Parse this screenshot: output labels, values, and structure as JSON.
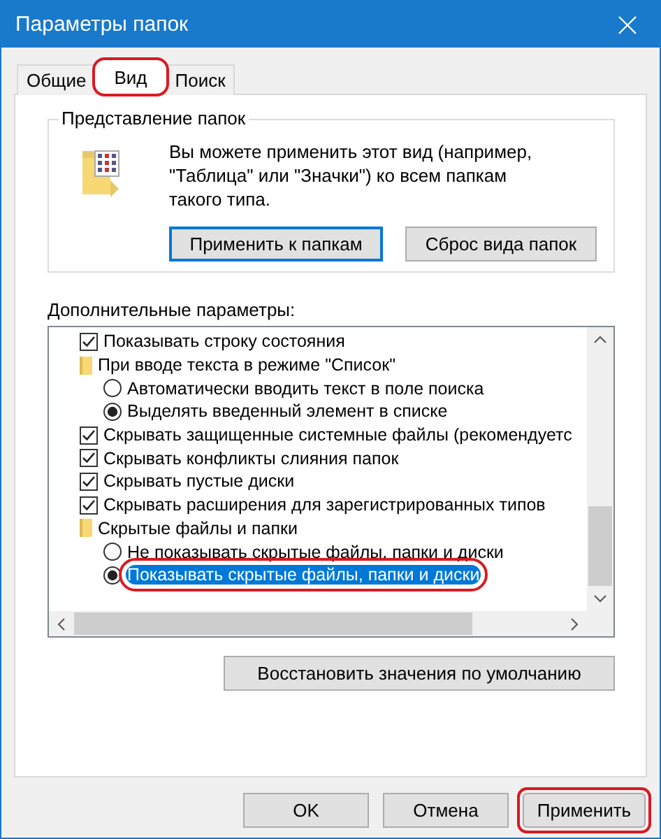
{
  "window": {
    "title": "Параметры папок"
  },
  "tabs": [
    {
      "label": "Общие",
      "selected": false,
      "circled": false
    },
    {
      "label": "Вид",
      "selected": true,
      "circled": true
    },
    {
      "label": "Поиск",
      "selected": false,
      "circled": false
    }
  ],
  "folder_views": {
    "title": "Представление папок",
    "description": "Вы можете применить этот вид (например, \"Таблица\" или \"Значки\") ко всем папкам такого типа.",
    "buttons": [
      {
        "label": "Применить к папкам",
        "focused": true
      },
      {
        "label": "Сброс вида папок",
        "focused": false
      }
    ]
  },
  "advanced": {
    "label": "Дополнительные параметры:",
    "items": [
      {
        "kind": "checkbox",
        "label": "Показывать строку состояния",
        "checked": true
      },
      {
        "kind": "folder",
        "label": "При вводе текста в режиме \"Список\"",
        "children": [
          {
            "kind": "radio",
            "label": "Автоматически вводить текст в поле поиска",
            "selected": false,
            "highlighted": false,
            "circled": false
          },
          {
            "kind": "radio",
            "label": "Выделять введенный элемент в списке",
            "selected": true,
            "highlighted": false,
            "circled": false
          }
        ]
      },
      {
        "kind": "checkbox",
        "label": "Скрывать защищенные системные файлы (рекомендуетс",
        "checked": true
      },
      {
        "kind": "checkbox",
        "label": "Скрывать конфликты слияния папок",
        "checked": true
      },
      {
        "kind": "checkbox",
        "label": "Скрывать пустые диски",
        "checked": true
      },
      {
        "kind": "checkbox",
        "label": "Скрывать расширения для зарегистрированных типов",
        "checked": true
      },
      {
        "kind": "folder",
        "label": "Скрытые файлы и папки",
        "children": [
          {
            "kind": "radio",
            "label": "Не показывать скрытые файлы, папки и диски",
            "selected": false,
            "highlighted": false,
            "circled": false
          },
          {
            "kind": "radio",
            "label": "Показывать скрытые файлы, папки и диски",
            "selected": true,
            "highlighted": true,
            "circled": true
          }
        ]
      }
    ],
    "restore_button": "Восстановить значения по умолчанию"
  },
  "buttons": [
    {
      "label": "OK",
      "circled": false
    },
    {
      "label": "Отмена",
      "circled": false
    },
    {
      "label": "Применить",
      "circled": true
    }
  ]
}
